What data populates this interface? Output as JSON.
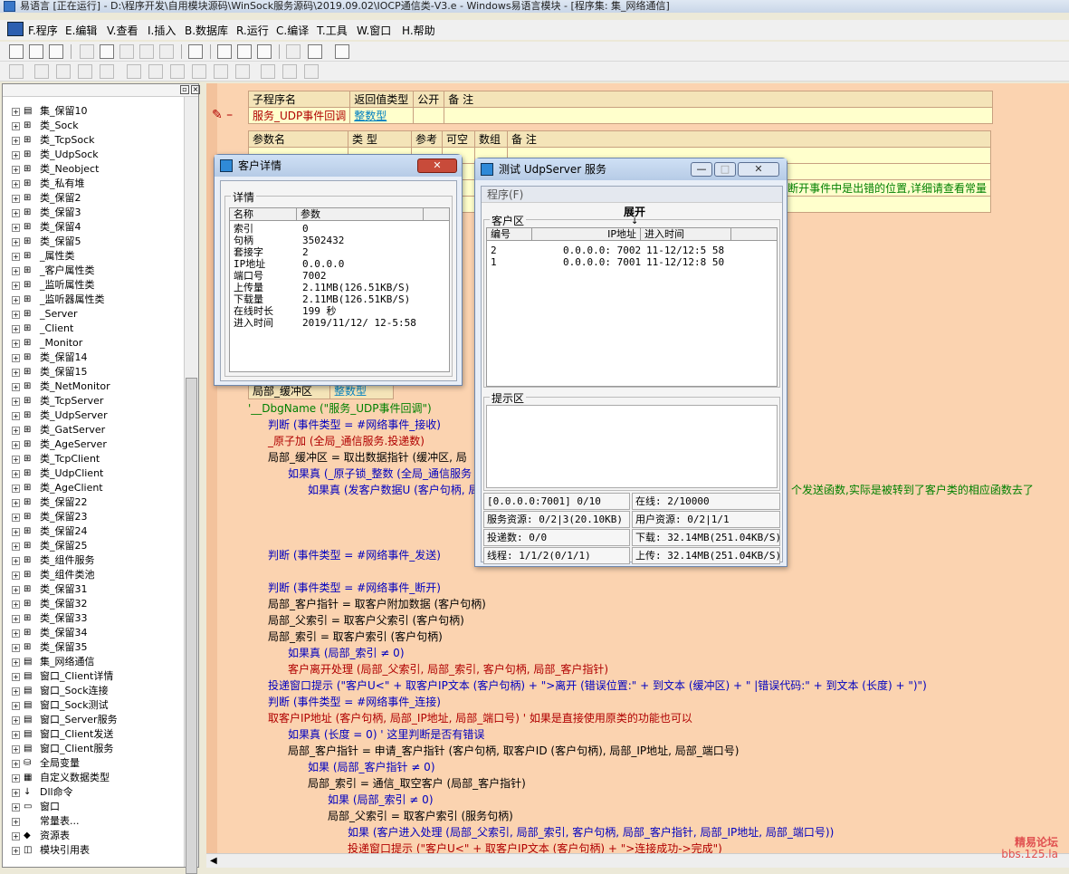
{
  "app": {
    "title": "易语言 [正在运行] - D:\\程序开发\\自用模块源码\\WinSock服务源码\\2019.09.02\\IOCP通信类-V3.e - Windows易语言模块 - [程序集: 集_网络通信]"
  },
  "menu": [
    "F.程序",
    "E.编辑",
    "V.查看",
    "I.插入",
    "B.数据库",
    "R.运行",
    "C.编译",
    "T.工具",
    "W.窗口",
    "H.帮助"
  ],
  "tree": {
    "items": [
      {
        "label": "集_保留10",
        "icon": "stack-icon"
      },
      {
        "label": "类_Sock",
        "icon": "class-icon"
      },
      {
        "label": "类_TcpSock",
        "icon": "class-icon"
      },
      {
        "label": "类_UdpSock",
        "icon": "class-icon"
      },
      {
        "label": "类_Neobject",
        "icon": "class-icon"
      },
      {
        "label": "类_私有堆",
        "icon": "class-icon"
      },
      {
        "label": "类_保留2",
        "icon": "class-icon"
      },
      {
        "label": "类_保留3",
        "icon": "class-icon"
      },
      {
        "label": "类_保留4",
        "icon": "class-icon"
      },
      {
        "label": "类_保留5",
        "icon": "class-icon"
      },
      {
        "label": "_属性类",
        "icon": "class-icon"
      },
      {
        "label": "_客户属性类",
        "icon": "class-icon"
      },
      {
        "label": "_监听属性类",
        "icon": "class-icon"
      },
      {
        "label": "_监听器属性类",
        "icon": "class-icon"
      },
      {
        "label": "_Server",
        "icon": "class-icon"
      },
      {
        "label": "_Client",
        "icon": "class-icon"
      },
      {
        "label": "_Monitor",
        "icon": "class-icon"
      },
      {
        "label": "类_保留14",
        "icon": "class-icon"
      },
      {
        "label": "类_保留15",
        "icon": "class-icon"
      },
      {
        "label": "类_NetMonitor",
        "icon": "class-icon"
      },
      {
        "label": "类_TcpServer",
        "icon": "class-icon"
      },
      {
        "label": "类_UdpServer",
        "icon": "class-icon"
      },
      {
        "label": "类_GatServer",
        "icon": "class-icon"
      },
      {
        "label": "类_AgeServer",
        "icon": "class-icon"
      },
      {
        "label": "类_TcpClient",
        "icon": "class-icon"
      },
      {
        "label": "类_UdpClient",
        "icon": "class-icon"
      },
      {
        "label": "类_AgeClient",
        "icon": "class-icon"
      },
      {
        "label": "类_保留22",
        "icon": "class-icon"
      },
      {
        "label": "类_保留23",
        "icon": "class-icon"
      },
      {
        "label": "类_保留24",
        "icon": "class-icon"
      },
      {
        "label": "类_保留25",
        "icon": "class-icon"
      },
      {
        "label": "类_组件服务",
        "icon": "class-icon"
      },
      {
        "label": "类_组件类池",
        "icon": "class-icon"
      },
      {
        "label": "类_保留31",
        "icon": "class-icon"
      },
      {
        "label": "类_保留32",
        "icon": "class-icon"
      },
      {
        "label": "类_保留33",
        "icon": "class-icon"
      },
      {
        "label": "类_保留34",
        "icon": "class-icon"
      },
      {
        "label": "类_保留35",
        "icon": "class-icon"
      },
      {
        "label": "集_网络通信",
        "icon": "stack-icon"
      },
      {
        "label": "窗口_Client详情",
        "icon": "stack-icon"
      },
      {
        "label": "窗口_Sock连接",
        "icon": "stack-icon"
      },
      {
        "label": "窗口_Sock测试",
        "icon": "stack-icon"
      },
      {
        "label": "窗口_Server服务",
        "icon": "stack-icon"
      },
      {
        "label": "窗口_Client发送",
        "icon": "stack-icon"
      },
      {
        "label": "窗口_Client服务",
        "icon": "stack-icon"
      },
      {
        "label": "全局变量",
        "icon": "db-icon"
      },
      {
        "label": "自定义数据类型",
        "icon": "type-icon"
      },
      {
        "label": "Dll命令",
        "icon": "dll-icon"
      },
      {
        "label": "窗口",
        "icon": "window-icon"
      },
      {
        "label": "常量表...",
        "icon": "none"
      },
      {
        "label": "资源表",
        "icon": "resource-icon"
      },
      {
        "label": "模块引用表",
        "icon": "module-icon"
      }
    ]
  },
  "table": {
    "h1": [
      "子程序名",
      "返回值类型",
      "公开",
      "备 注"
    ],
    "r1": [
      "服务_UDP事件回调",
      "整数型",
      "",
      ""
    ],
    "h2": [
      "参数名",
      "类 型",
      "参考",
      "可空",
      "数组",
      "备 注"
    ],
    "note": "断开事件中是出错的位置,详细请查看常量",
    "local": "局部_缓冲区",
    "local_type": "整数型"
  },
  "code": [
    [
      "'__DbgName (\"服务_UDP事件回调\")",
      "g"
    ],
    [
      "判断 (事件类型 = #网络事件_接收)",
      "k"
    ],
    [
      "_原子加 (全局_通信服务.投递数)",
      "r"
    ],
    [
      "局部_缓冲区 = 取出数据指针 (缓冲区, 局",
      "dk"
    ],
    [
      "如果真 (_原子锁_整数 (全局_通信服务",
      "k"
    ],
    [
      "如果真 (发客户数据U (客户句柄, 局",
      "k"
    ],
    [
      "判断 (事件类型 = #网络事件_发送)",
      "k"
    ],
    [
      "判断 (事件类型 = #网络事件_断开)",
      "k"
    ],
    [
      "局部_客户指针 = 取客户附加数据 (客户句柄)",
      "dk"
    ],
    [
      "局部_父索引 = 取客户父索引 (客户句柄)",
      "dk"
    ],
    [
      "局部_索引 = 取客户索引 (客户句柄)",
      "dk"
    ],
    [
      "如果真 (局部_索引 ≠ 0)",
      "k"
    ],
    [
      "客户离开处理 (局部_父索引, 局部_索引, 客户句柄, 局部_客户指针)",
      "r"
    ],
    [
      "投递窗口提示 (\"客户U<\" + 取客户IP文本 (客户句柄) + \">离开 (错误位置:\" + 到文本 (缓冲区) + \" |错误代码:\" + 到文本 (长度) + \")\")",
      "k"
    ],
    [
      "判断 (事件类型 = #网络事件_连接)",
      "k"
    ],
    [
      "取客户IP地址 (客户句柄, 局部_IP地址, 局部_端口号)  ' 如果是直接使用原类的功能也可以",
      "r"
    ],
    [
      "如果真 (长度 = 0)  ' 这里判断是否有错误",
      "k"
    ],
    [
      "局部_客户指针 = 申请_客户指针 (客户句柄, 取客户ID (客户句柄), 局部_IP地址, 局部_端口号)",
      "dk"
    ],
    [
      "如果 (局部_客户指针 ≠ 0)",
      "k"
    ],
    [
      "局部_索引 = 通信_取空客户 (局部_客户指针)",
      "dk"
    ],
    [
      "如果 (局部_索引 ≠ 0)",
      "k"
    ],
    [
      "局部_父索引 = 取客户索引 (服务句柄)",
      "dk"
    ],
    [
      "如果 (客户进入处理 (局部_父索引, 局部_索引, 客户句柄, 局部_客户指针, 局部_IP地址, 局部_端口号))",
      "k"
    ],
    [
      "投递窗口提示 (\"客户U<\" + 取客户IP文本 (客户句柄) + \">连接成功->完成\")",
      "r"
    ]
  ],
  "code_tail": "个发送函数,实际是被转到了客户类的相应函数去了",
  "client_win": {
    "title": "客户详情",
    "group": "详情",
    "cols": [
      "名称",
      "参数"
    ],
    "rows": [
      [
        "索引",
        "0"
      ],
      [
        "句柄",
        "3502432"
      ],
      [
        "套接字",
        "2"
      ],
      [
        "IP地址",
        "0.0.0.0"
      ],
      [
        "端口号",
        "7002"
      ],
      [
        "上传量",
        "2.11MB(126.51KB/S)"
      ],
      [
        "下载量",
        "2.11MB(126.51KB/S)"
      ],
      [
        "在线时长",
        "199 秒"
      ],
      [
        "进入时间",
        "2019/11/12/ 12-5:58"
      ]
    ]
  },
  "udp_win": {
    "title": "测试 UdpServer 服务",
    "menu": "程序(F)",
    "group_client": "客户区",
    "expand": "展开",
    "cols": [
      "编号",
      "IP地址",
      "进入时间"
    ],
    "rows": [
      [
        "2",
        "0.0.0.0: 7002",
        "11-12/12:5 58"
      ],
      [
        "1",
        "0.0.0.0: 7001",
        "11-12/12:8 50"
      ]
    ],
    "group_tip": "提示区",
    "status": [
      [
        "[0.0.0.0:7001] 0/10",
        "在线: 2/10000"
      ],
      [
        "服务资源: 0/2|3(20.10KB)",
        "用户资源: 0/2|1/1"
      ],
      [
        "投递数: 0/0",
        "下载: 32.14MB(251.04KB/S)"
      ],
      [
        "线程: 1/1/2(0/1/1)",
        "上传: 32.14MB(251.04KB/S)"
      ]
    ]
  },
  "watermark": {
    "line1": "精易论坛",
    "line2": "bbs.125.la"
  }
}
